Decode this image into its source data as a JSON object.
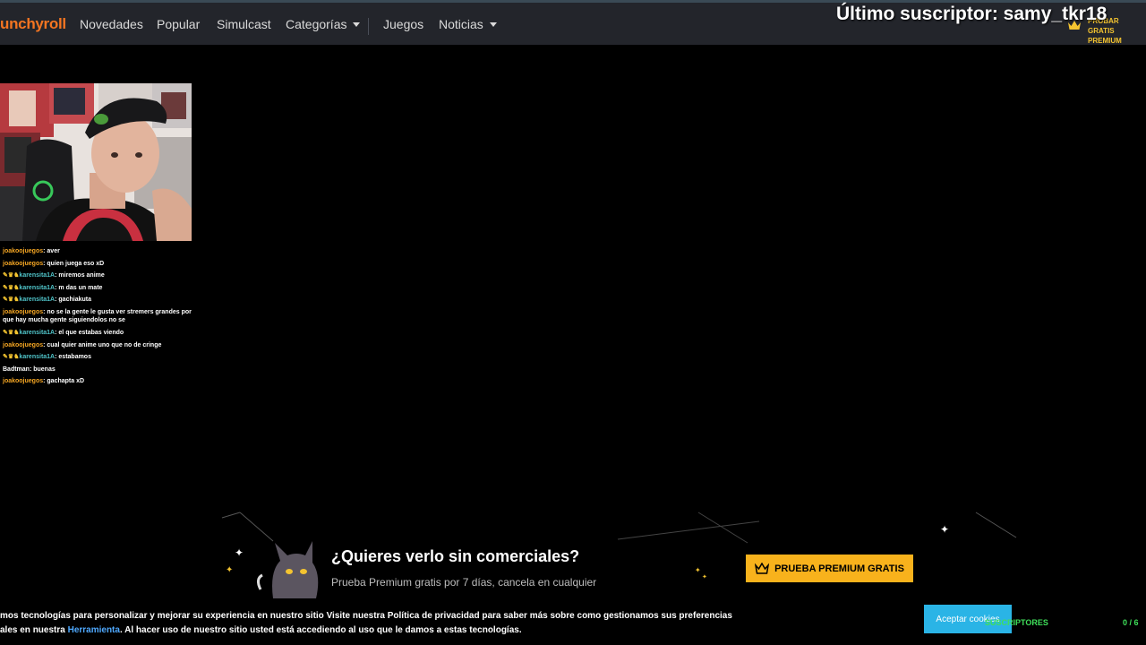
{
  "nav": {
    "logo": "unchyroll",
    "items": [
      "Novedades",
      "Popular",
      "Simulcast",
      "Categorías",
      "Juegos",
      "Noticias"
    ],
    "premium_line1": "PROBAR GRATIS",
    "premium_line2": "PREMIUM"
  },
  "overlay": {
    "last_subscriber": "Último suscriptor: samy_tkr18",
    "subs_label": "SUSCRIPTORES",
    "subs_count": "0 / 6"
  },
  "chat": {
    "messages": [
      {
        "user": "joakoojuegos",
        "text": "aver"
      },
      {
        "user": "joakoojuegos",
        "text": "quien juega eso xD"
      },
      {
        "user": "karensita1A",
        "text": "miremos anime"
      },
      {
        "user": "karensita1A",
        "text": "m das un mate"
      },
      {
        "user": "karensita1A",
        "text": "gachiakuta"
      },
      {
        "user": "joakoojuegos",
        "text": "no se la gente le gusta ver stremers grandes por que hay mucha gente siguiendolos no se"
      },
      {
        "user": "karensita1A",
        "text": "el que estabas viendo"
      },
      {
        "user": "joakoojuegos",
        "text": "cual quier anime uno que no de cringe"
      },
      {
        "user": "karensita1A",
        "text": "estabamos"
      },
      {
        "user": "Badtman",
        "text": "buenas"
      },
      {
        "user": "joakoojuegos",
        "text": "gachapta xD"
      }
    ]
  },
  "promo": {
    "title": "¿Quieres verlo sin comerciales?",
    "subtitle": "Prueba Premium gratis por 7 días, cancela en cualquier",
    "button": "PRUEBA PREMIUM GRATIS"
  },
  "cookie": {
    "line1": "mos tecnologías para personalizar y mejorar su experiencia en nuestro sitio Visite nuestra Política de privacidad para saber más sobre como gestionamos sus preferencias",
    "line2_pre": "ales en nuestra ",
    "line2_link": "Herramienta",
    "line2_post": ". Al hacer uso de nuestro sitio usted está accediendo al uso que le damos a estas tecnologías.",
    "accept": "Aceptar cookies"
  },
  "colors": {
    "brand": "#f47521",
    "premium": "#f8b21c",
    "cookie_button": "#2ab4e6",
    "chat_user": "#f5a623",
    "chat_user_sub": "#4fc3c8",
    "overlay_green": "#3fe05a"
  }
}
